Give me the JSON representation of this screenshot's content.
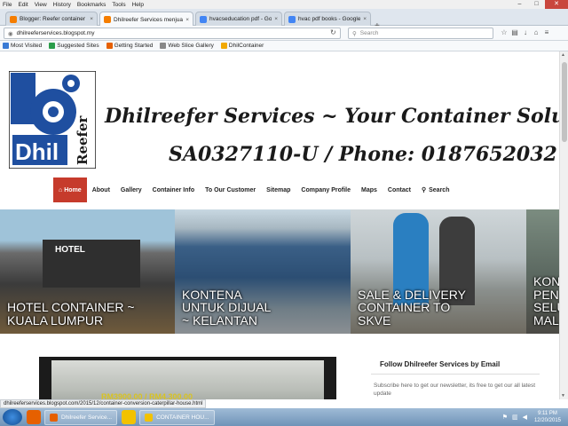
{
  "menu": [
    "File",
    "Edit",
    "View",
    "History",
    "Bookmarks",
    "Tools",
    "Help"
  ],
  "window_controls": {
    "minimize": "–",
    "maximize": "□",
    "close": "✕"
  },
  "tabs": [
    {
      "label": "Blogger: Reefer container ...",
      "favicon_color": "#f57d00",
      "active": false
    },
    {
      "label": "Dhilreefer Services menjual...",
      "favicon_color": "#f57d00",
      "active": true
    },
    {
      "label": "hvacseducation pdf - Goog...",
      "favicon_color": "#4285f4",
      "active": false
    },
    {
      "label": "hvac pdf books - Google S...",
      "favicon_color": "#4285f4",
      "active": false
    }
  ],
  "tab_close": "×",
  "new_tab": "+",
  "url": "dhilreeferservices.blogspot.my",
  "search_placeholder": "Search",
  "nav_icons": [
    "star-icon",
    "clipboard-icon",
    "download-icon",
    "home-icon",
    "menu-icon"
  ],
  "nav_glyphs": [
    "☆",
    "▤",
    "↓",
    "⌂",
    "≡"
  ],
  "bookmarks": [
    {
      "label": "Most Visited",
      "color": "#3a7bd5"
    },
    {
      "label": "Suggested Sites",
      "color": "#2a9d4a"
    },
    {
      "label": "Getting Started",
      "color": "#e66000"
    },
    {
      "label": "Web Slice Gallery",
      "color": "#888888"
    },
    {
      "label": "DhilContainer",
      "color": "#f2a900"
    }
  ],
  "header": {
    "logo_word": "Dhil",
    "logo_side": "Reefer",
    "line1": "Dhilreefer Services ~ Your Container Solution",
    "line2": "SA0327110-U / Phone: 0187652032"
  },
  "site_nav": [
    "Home",
    "About",
    "Gallery",
    "Container Info",
    "To Our Customer",
    "Sitemap",
    "Company Profile",
    "Maps",
    "Contact",
    "Search"
  ],
  "slides": [
    {
      "caption": "HOTEL CONTAINER ~ KUALA LUMPUR",
      "sign": "HOTEL"
    },
    {
      "caption": "KONTENA UNTUK DIJUAL ~ KELANTAN"
    },
    {
      "caption": "SALE & DELIVERY CONTAINER TO SKVE"
    },
    {
      "caption": "KON PEN SELU MAL"
    }
  ],
  "sidebar": {
    "follow_title": "Follow Dhilreefer Services by Email",
    "follow_text": "Subscribe here to get our newsletter, its free to get our all latest update"
  },
  "lower_image_text": "RM3900.00 / RM4,300.00",
  "status_url": "dhilreeferservices.blogspot.com/2015/12/container-conversion-caterpillar-house.html",
  "taskbar": {
    "items": [
      {
        "label": "Dhilreefer Service...",
        "color": "#e66000"
      },
      {
        "label": "CONTAINER HOU...",
        "color": "#f2c200"
      }
    ],
    "time": "9:11 PM",
    "date": "12/20/2015"
  }
}
